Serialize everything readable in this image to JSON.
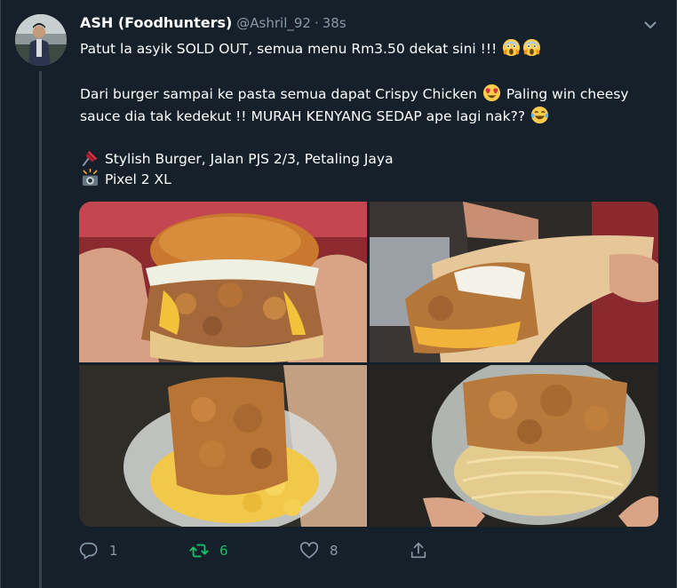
{
  "tweet": {
    "author_name": "ASH (Foodhunters)",
    "handle": "@Ashril_92",
    "separator": "·",
    "time": "38s",
    "line1": "Patut la asyik SOLD OUT, semua menu Rm3.50 dekat sini !!!",
    "line2": "Dari burger sampai ke pasta semua dapat Crispy Chicken",
    "line2b": "Paling win cheesy",
    "line3": "sauce dia tak kedekut !! MURAH KENYANG SEDAP ape lagi nak??",
    "line4": "Stylish Burger, Jalan PJS 2/3, Petaling Jaya",
    "line5": "Pixel 2 XL"
  },
  "icons": {
    "menu": "chevron-down-icon",
    "reply": "reply-icon",
    "retweet": "retweet-icon",
    "like": "heart-icon",
    "share": "share-icon",
    "pin": "pushpin-emoji",
    "camera": "camera-flash-emoji",
    "scream": "scream-emoji",
    "heart_eyes": "heart-eyes-emoji",
    "laugh": "tears-of-joy-emoji"
  },
  "actions": {
    "reply_count": "1",
    "retweet_count": "6",
    "like_count": "8"
  },
  "colors": {
    "background": "#15202b",
    "muted": "#8899a6",
    "retweet_active": "#17bf63",
    "border": "#38444d"
  },
  "media": {
    "photos": [
      "burger-photo",
      "wrap-photo",
      "mac-and-cheese-photo",
      "pasta-photo"
    ]
  }
}
